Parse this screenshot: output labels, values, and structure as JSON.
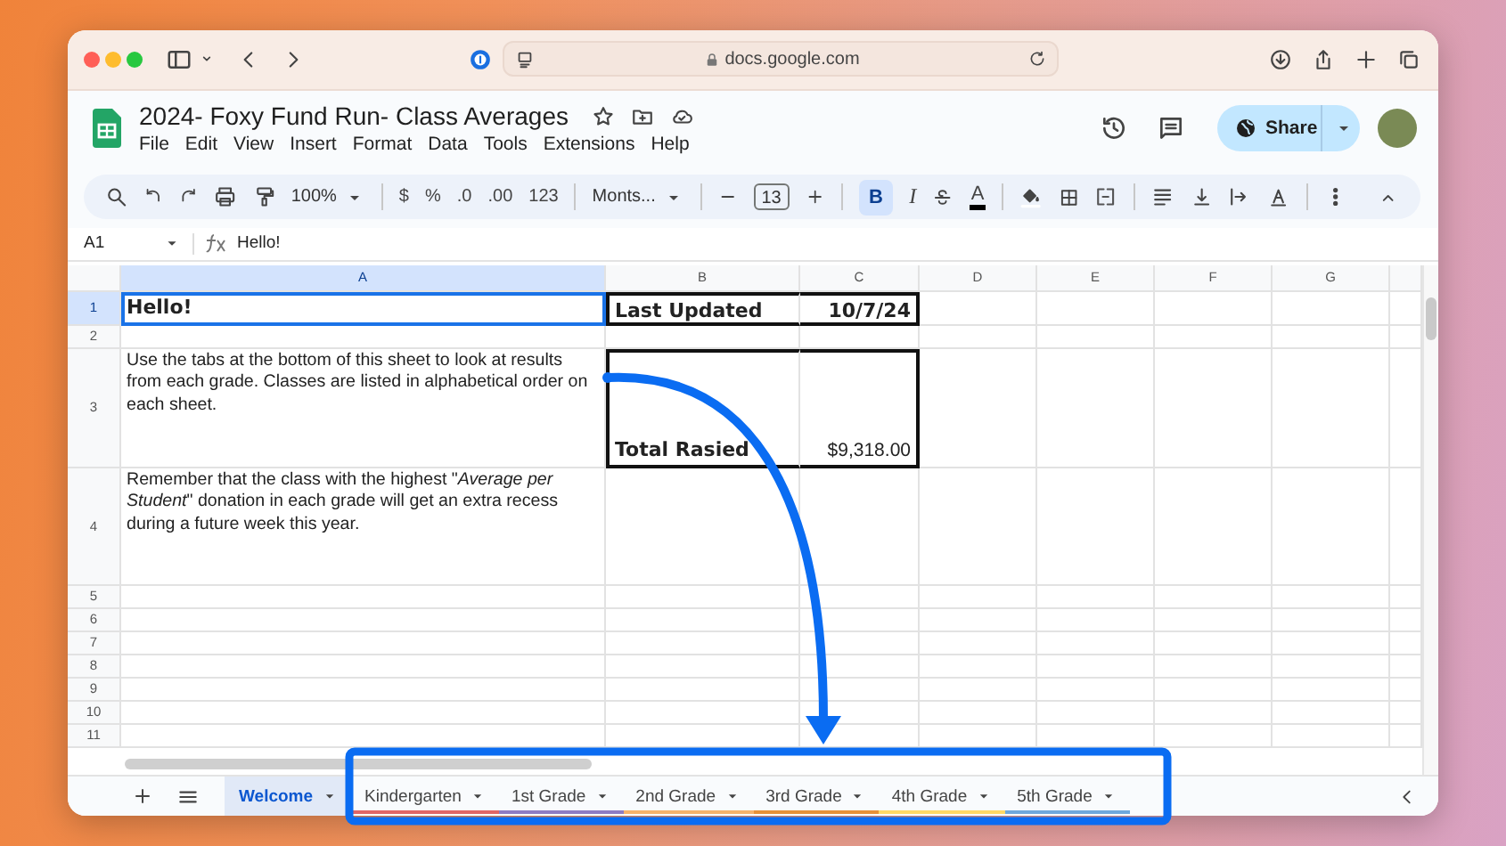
{
  "browser": {
    "url": "docs.google.com"
  },
  "document": {
    "title": "2024- Foxy Fund Run- Class Averages",
    "menu": [
      "File",
      "Edit",
      "View",
      "Insert",
      "Format",
      "Data",
      "Tools",
      "Extensions",
      "Help"
    ],
    "share_label": "Share"
  },
  "toolbar": {
    "zoom": "100%",
    "currency": "$",
    "percent": "%",
    "decrease_decimals": ".0",
    "increase_decimals": ".00",
    "number_format": "123",
    "font": "Monts...",
    "font_size": "13",
    "bold_label": "B",
    "bold_active": true,
    "italic_label": "I",
    "text_color_label": "A"
  },
  "formula_bar": {
    "cell_ref": "A1",
    "content": "Hello!"
  },
  "grid": {
    "columns": [
      {
        "label": "A",
        "selected": true
      },
      {
        "label": "B",
        "selected": false
      },
      {
        "label": "C",
        "selected": false
      },
      {
        "label": "D",
        "selected": false
      },
      {
        "label": "E",
        "selected": false
      },
      {
        "label": "F",
        "selected": false
      },
      {
        "label": "G",
        "selected": false
      }
    ],
    "rows": [
      {
        "label": "1",
        "selected": true,
        "boxed": true,
        "cells": [
          "Hello!",
          "Last Updated",
          "10/7/24"
        ]
      },
      {
        "label": "2",
        "selected": false,
        "boxed": false
      },
      {
        "label": "3",
        "selected": false,
        "boxed": true,
        "cells": [
          "Use the tabs at the bottom of this sheet to look at results from each grade. Classes are listed in alphabetical order on each sheet.",
          "Total Rasied",
          "$9,318.00"
        ]
      },
      {
        "label": "4",
        "selected": false,
        "boxed": false,
        "cells": [
          "Remember that the class with the highest \"*Average per Student*\" donation in each grade will get an extra recess during a future week this year."
        ]
      },
      {
        "label": "5",
        "selected": false,
        "boxed": false
      },
      {
        "label": "6",
        "selected": false,
        "boxed": false
      },
      {
        "label": "7",
        "selected": false,
        "boxed": false
      },
      {
        "label": "8",
        "selected": false,
        "boxed": false
      },
      {
        "label": "9",
        "selected": false,
        "boxed": false
      },
      {
        "label": "10",
        "selected": false,
        "boxed": false
      },
      {
        "label": "11",
        "selected": false,
        "boxed": false
      }
    ]
  },
  "sheet_tabs": [
    {
      "label": "Welcome",
      "selected": true
    },
    {
      "label": "Kindergarten",
      "selected": false,
      "color": "#e06666"
    },
    {
      "label": "1st Grade",
      "selected": false,
      "color": "#8e7cc3"
    },
    {
      "label": "2nd Grade",
      "selected": false,
      "color": "#f6b26b"
    },
    {
      "label": "3rd Grade",
      "selected": false,
      "color": "#e69138"
    },
    {
      "label": "4th Grade",
      "selected": false,
      "color": "#ffd966"
    },
    {
      "label": "5th Grade",
      "selected": false,
      "color": "#6fa8dc"
    }
  ]
}
